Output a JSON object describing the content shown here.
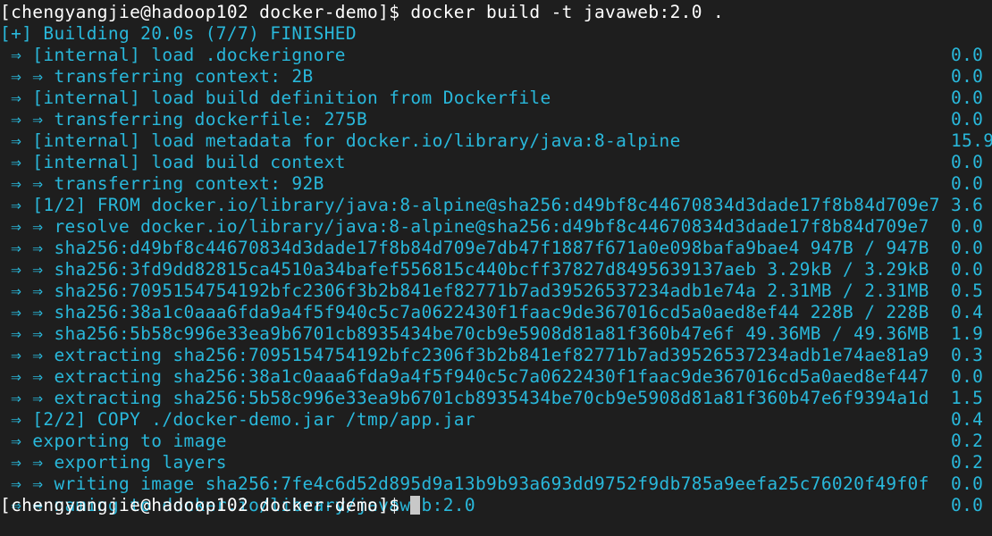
{
  "prompt": {
    "host_prompt": "[chengyangjie@hadoop102 docker-demo]$ ",
    "command": "docker build -t javaweb:2.0 ."
  },
  "status_line": "[+] Building 20.0s (7/7) FINISHED",
  "steps": [
    {
      "text": " ⇒ [internal] load .dockerignore",
      "time": "0.0"
    },
    {
      "text": " ⇒ ⇒ transferring context: 2B",
      "time": "0.0"
    },
    {
      "text": " ⇒ [internal] load build definition from Dockerfile",
      "time": "0.0"
    },
    {
      "text": " ⇒ ⇒ transferring dockerfile: 275B",
      "time": "0.0"
    },
    {
      "text": " ⇒ [internal] load metadata for docker.io/library/java:8-alpine",
      "time": "15.9"
    },
    {
      "text": " ⇒ [internal] load build context",
      "time": "0.0"
    },
    {
      "text": " ⇒ ⇒ transferring context: 92B",
      "time": "0.0"
    },
    {
      "text": " ⇒ [1/2] FROM docker.io/library/java:8-alpine@sha256:d49bf8c44670834d3dade17f8b84d709e7",
      "time": "3.6"
    },
    {
      "text": " ⇒ ⇒ resolve docker.io/library/java:8-alpine@sha256:d49bf8c44670834d3dade17f8b84d709e7",
      "time": "0.0"
    },
    {
      "text": " ⇒ ⇒ sha256:d49bf8c44670834d3dade17f8b84d709e7db47f1887f671a0e098bafa9bae4 947B / 947B",
      "time": "0.0"
    },
    {
      "text": " ⇒ ⇒ sha256:3fd9dd82815ca4510a34bafef556815c440bcff37827d8495639137aeb 3.29kB / 3.29kB",
      "time": "0.0"
    },
    {
      "text": " ⇒ ⇒ sha256:7095154754192bfc2306f3b2b841ef82771b7ad39526537234adb1e74a 2.31MB / 2.31MB",
      "time": "0.5"
    },
    {
      "text": " ⇒ ⇒ sha256:38a1c0aaa6fda9a4f5f940c5c7a0622430f1faac9de367016cd5a0aed8ef44 228B / 228B",
      "time": "0.4"
    },
    {
      "text": " ⇒ ⇒ sha256:5b58c996e33ea9b6701cb8935434be70cb9e5908d81a81f360b47e6f 49.36MB / 49.36MB",
      "time": "1.9"
    },
    {
      "text": " ⇒ ⇒ extracting sha256:7095154754192bfc2306f3b2b841ef82771b7ad39526537234adb1e74ae81a9",
      "time": "0.3"
    },
    {
      "text": " ⇒ ⇒ extracting sha256:38a1c0aaa6fda9a4f5f940c5c7a0622430f1faac9de367016cd5a0aed8ef447",
      "time": "0.0"
    },
    {
      "text": " ⇒ ⇒ extracting sha256:5b58c996e33ea9b6701cb8935434be70cb9e5908d81a81f360b47e6f9394a1d",
      "time": "1.5"
    },
    {
      "text": " ⇒ [2/2] COPY ./docker-demo.jar /tmp/app.jar",
      "time": "0.4"
    },
    {
      "text": " ⇒ exporting to image",
      "time": "0.2"
    },
    {
      "text": " ⇒ ⇒ exporting layers",
      "time": "0.2"
    },
    {
      "text": " ⇒ ⇒ writing image sha256:7fe4c6d52d895d9a13b9b93a693dd9752f9db785a9eefa25c76020f49f0f",
      "time": "0.0"
    },
    {
      "text": " ⇒ ⇒ naming to docker.io/library/javaweb:2.0",
      "time": "0.0"
    }
  ],
  "final_prompt": "[chengyangjie@hadoop102 docker-demo]$ ",
  "colors": {
    "background": "#1e1e1e",
    "text": "#ffffff",
    "accent": "#29b8db",
    "cursor": "#c8c8c8"
  }
}
